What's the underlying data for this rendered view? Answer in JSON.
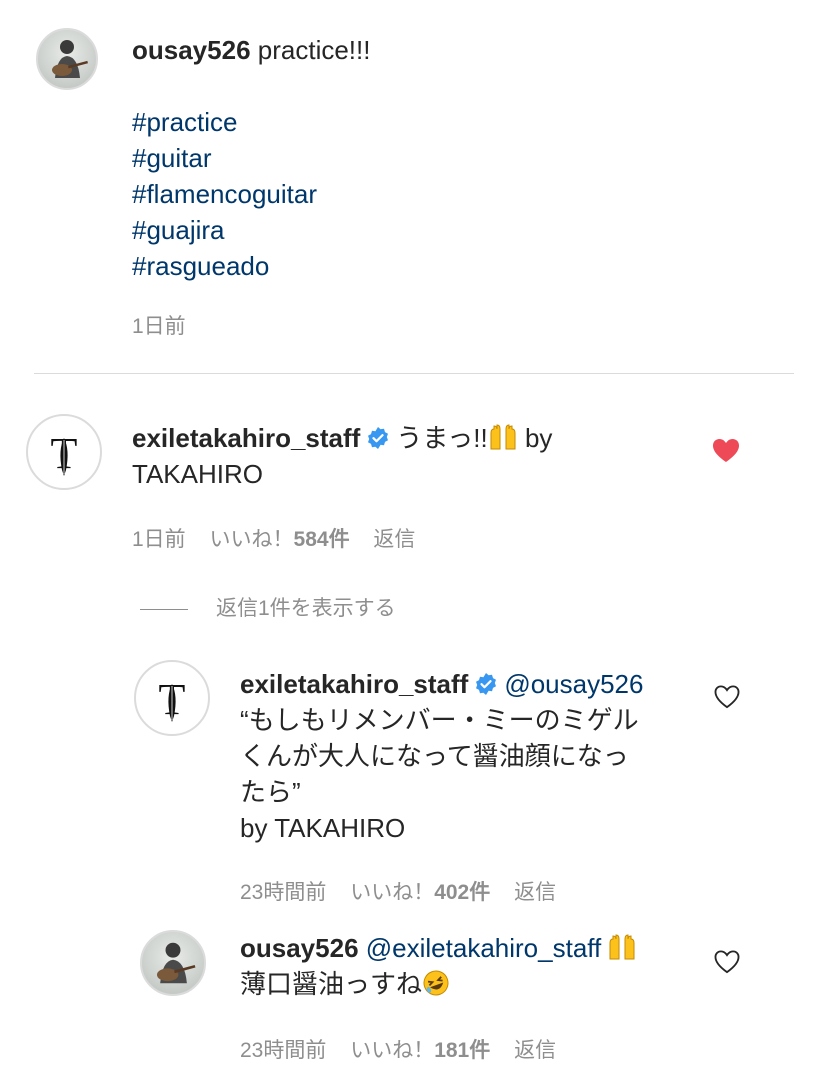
{
  "post": {
    "username": "ousay526",
    "caption": "practice!!!",
    "hashtags": [
      "#practice",
      "#guitar",
      "#flamencoguitar",
      "#guajira",
      "#rasgueado"
    ],
    "time": "1日前"
  },
  "comments": [
    {
      "username": "exiletakahiro_staff",
      "verified": true,
      "text": "うまっ!!",
      "emoji": "raised-hands-icon",
      "text_after": " by",
      "line2": "TAKAHIRO",
      "time": "1日前",
      "likes_prefix": "いいね！",
      "likes_count": "584件",
      "reply": "返信",
      "liked": true,
      "view_replies": "返信1件を表示する"
    }
  ],
  "replies": [
    {
      "username": "exiletakahiro_staff",
      "verified": true,
      "mention": "@ousay526",
      "lines": [
        "“もしもリメンバー・ミーのミゲル",
        "くんが大人になって醤油顔になっ",
        "たら”",
        "by TAKAHIRO"
      ],
      "time": "23時間前",
      "likes_prefix": "いいね！",
      "likes_count": "402件",
      "reply": "返信",
      "liked": false
    },
    {
      "username": "ousay526",
      "verified": false,
      "mention": "@exiletakahiro_staff",
      "emoji_after_mention": "raised-hands-icon",
      "text": "薄口醤油っすね",
      "emoji": "rolling-laughing-icon",
      "time": "23時間前",
      "likes_prefix": "いいね！",
      "likes_count": "181件",
      "reply": "返信",
      "liked": false
    }
  ],
  "colors": {
    "text": "#262626",
    "link": "#00376b",
    "secondary": "#8e8e8e",
    "verified": "#3897f0",
    "heart_liked": "#ed4956",
    "divider": "#dbdbdb"
  }
}
